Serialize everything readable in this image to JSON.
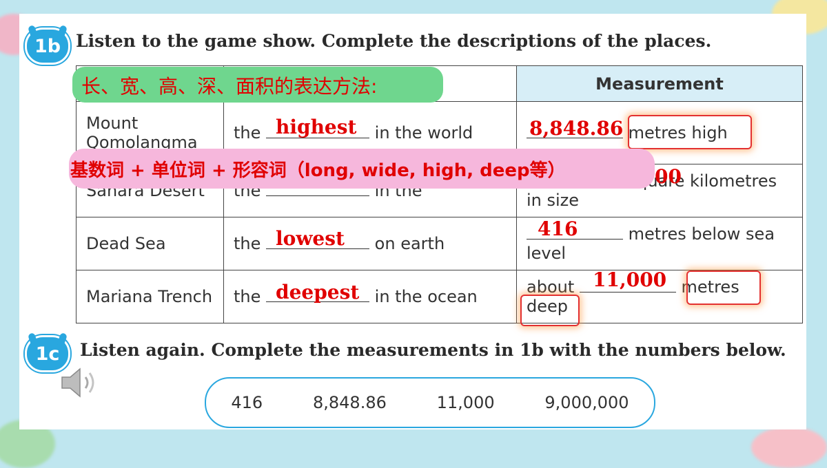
{
  "section_1b": {
    "badge": "1b",
    "instruction": "Listen to the game show. Complete the descriptions of the places."
  },
  "table": {
    "header_measurement": "Measurement",
    "rows": [
      {
        "place": "Mount Qomolangma",
        "pre": "the",
        "answer": "highest",
        "post": "in the world",
        "measure_number": "8,848.86",
        "measure_text": "metres high"
      },
      {
        "place": "Sahara Desert",
        "pre": "the",
        "answer": "",
        "post": "in the",
        "measure_number": "00",
        "measure_text": "square kilometres in size"
      },
      {
        "place": "Dead Sea",
        "pre": "the",
        "answer": "lowest",
        "post": "on earth",
        "measure_number": "416",
        "measure_text": "metres below sea level"
      },
      {
        "place": "Mariana Trench",
        "pre": "the",
        "answer": "deepest",
        "post": "in the ocean",
        "measure_prefix": "about",
        "measure_number": "11,000",
        "measure_text1": "metres",
        "measure_text2": "deep"
      }
    ]
  },
  "notes": {
    "green": "长、宽、高、深、面积的表达方法:",
    "pink": "基数词 + 单位词 + 形容词（long, wide, high, deep等）"
  },
  "section_1c": {
    "badge": "1c",
    "instruction": "Listen again. Complete the measurements in 1b with the numbers below.",
    "numbers": [
      "416",
      "8,848.86",
      "11,000",
      "9,000,000"
    ]
  },
  "icons": {
    "speaker": "speaker-icon"
  },
  "colors": {
    "accent": "#29a7df",
    "answer": "#e00000",
    "green_highlight": "#6fd68e",
    "pink_highlight": "#f6b7dc"
  }
}
